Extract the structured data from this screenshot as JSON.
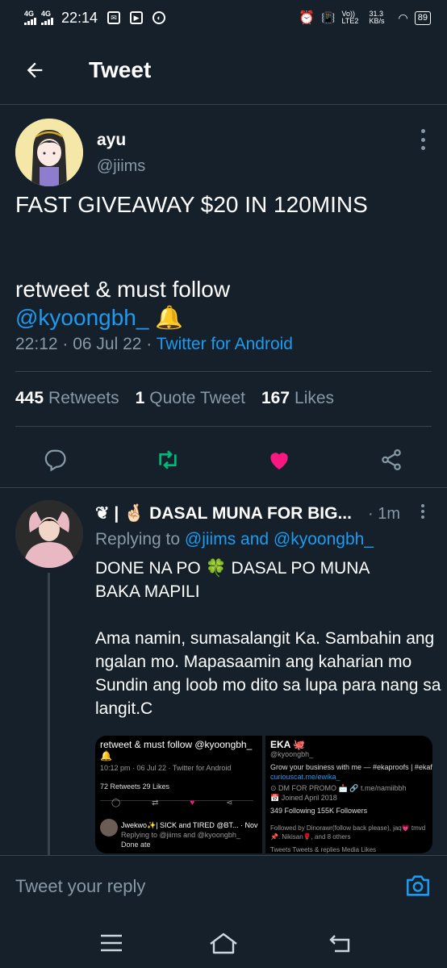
{
  "status_bar": {
    "net1": "4G",
    "net2": "4G",
    "time": "22:14",
    "volte": "Vo)) LTE2",
    "speed": "31.3 KB/s",
    "battery": "89"
  },
  "app_bar": {
    "title": "Tweet"
  },
  "tweet": {
    "name": "ayu",
    "handle": "@jiims",
    "text_line1": "FAST GIVEAWAY $20 IN 120MINS",
    "text_line2": "retweet & must follow",
    "mention": "@kyoongbh_",
    "emoji": "🔔",
    "timestamp": "22:12 · 06 Jul 22 · ",
    "source": "Twitter for Android",
    "retweets_count": "445",
    "retweets_label": "Retweets",
    "quote_count": "1",
    "quote_label": "Quote Tweet",
    "likes_count": "167",
    "likes_label": "Likes"
  },
  "reply": {
    "name": "❦ | 🤞🏻 DASAL MUNA FOR BIG...",
    "time": "· 1m",
    "replying_prefix": "Replying to ",
    "replying_to": "@jiims and @kyoongbh_",
    "text": "DONE NA PO 🍀 DASAL PO MUNA\nBAKA MAPILI\n\nAma namin, sumasalangit Ka. Sambahin ang ngalan mo. Mapasaamin ang kaharian mo Sundin ang loob mo dito sa lupa para nang sa langit.C",
    "media_left": {
      "line1": "retweet & must follow @kyoongbh_",
      "line2": "🔔",
      "line3": "10:12 pm · 06 Jul 22 · Twitter for Android",
      "line4": "72 Retweets  29 Likes",
      "line5": "Jwekwo✨| SICK and TIRED @BT... · Nov",
      "line6": "Replying to @jiims and @kyoongbh_",
      "line7": "Done ate"
    },
    "media_right": {
      "line1": "EKA 🐙",
      "line2": "@kyoongbh_",
      "line3": "Grow your business with me — #ekaproofs | #ekafam",
      "line4": "curiouscat.me/ewika_",
      "line5": "⊙ DM FOR PROMO 📩   🔗 t.me/namiibbh",
      "line6": "📅 Joined April 2018",
      "line7": "349 Following   155K Followers",
      "line8": "Followed by Dinorawr(follow back please), jaq💗 tmvd",
      "line9": "📌. Nikisan🌹, and 8 others",
      "line10": "Tweets      Tweets & replies      Media      Likes"
    }
  },
  "composer": {
    "placeholder": "Tweet your reply"
  },
  "colors": {
    "background": "#15202b",
    "accent": "#1d9bf0",
    "retweet": "#00ba7c",
    "like": "#f91880",
    "muted": "#8899a6"
  },
  "icons": [
    "back-arrow-icon",
    "more-icon",
    "reply-icon",
    "retweet-icon",
    "like-icon",
    "share-icon",
    "camera-icon",
    "menu-icon",
    "home-icon",
    "back-nav-icon"
  ]
}
